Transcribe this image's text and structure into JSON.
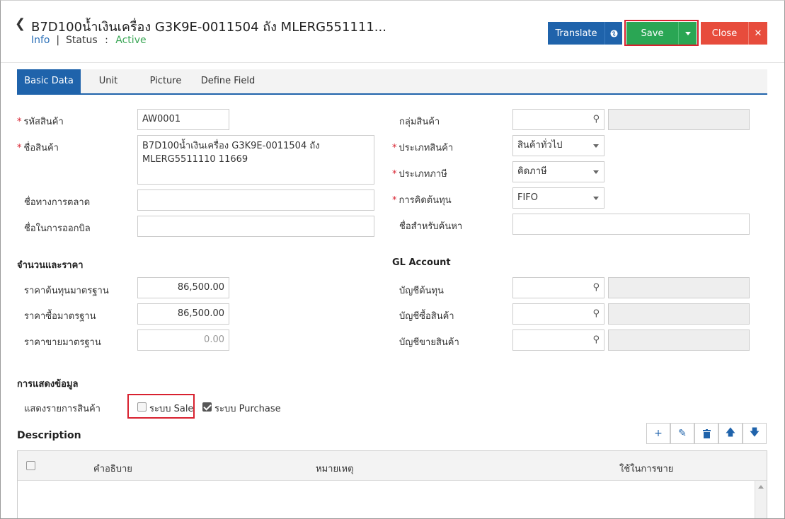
{
  "header": {
    "title": "B7D100น้ำเงินเครื่อง G3K9E-0011504 ถัง MLERG551111...",
    "info_link": "Info",
    "status_label": "Status",
    "status_sep": ":",
    "status_value": "Active",
    "translate_label": "Translate",
    "save_label": "Save",
    "close_label": "Close"
  },
  "tabs": [
    "Basic Data",
    "Unit",
    "Picture",
    "Define Field"
  ],
  "form": {
    "product_code_label": "รหัสสินค้า",
    "product_code_value": "AW0001",
    "product_name_label": "ชื่อสินค้า",
    "product_name_value": "B7D100น้ำเงินเครื่อง G3K9E-0011504 ถัง MLERG5511110 11669",
    "marketing_name_label": "ชื่อทางการตลาด",
    "marketing_name_value": "",
    "billing_name_label": "ชื่อในการออกบิล",
    "billing_name_value": "",
    "product_group_label": "กลุ่มสินค้า",
    "product_group_value": "",
    "product_type_label": "ประเภทสินค้า",
    "product_type_value": "สินค้าทั่วไป",
    "tax_type_label": "ประเภทภาษี",
    "tax_type_value": "คิดภาษี",
    "costing_label": "การคิดต้นทุน",
    "costing_value": "FIFO",
    "search_name_label": "ชื่อสำหรับค้นหา",
    "search_name_value": ""
  },
  "price_section": {
    "title": "จำนวนและราคา",
    "std_cost_label": "ราคาต้นทุนมาตรฐาน",
    "std_cost_value": "86,500.00",
    "std_buy_label": "ราคาซื้อมาตรฐาน",
    "std_buy_value": "86,500.00",
    "std_sell_label": "ราคาขายมาตรฐาน",
    "std_sell_placeholder": "0.00"
  },
  "gl_section": {
    "title": "GL Account",
    "cost_account_label": "บัญชีต้นทุน",
    "purchase_account_label": "บัญชีซื้อสินค้า",
    "sales_account_label": "บัญชีขายสินค้า"
  },
  "display_section": {
    "title": "การแสดงข้อมูล",
    "show_items_label": "แสดงรายการสินค้า",
    "sale_label": "ระบบ Sale",
    "sale_checked": false,
    "purchase_label": "ระบบ Purchase",
    "purchase_checked": true
  },
  "description": {
    "title": "Description",
    "columns": [
      "คำอธิบาย",
      "หมายเหตุ",
      "ใช้ในการขาย"
    ],
    "toolbar_icons": [
      "plus-icon",
      "pencil-icon",
      "trash-icon",
      "arrow-up-icon",
      "arrow-down-icon"
    ]
  },
  "colors": {
    "primary": "#1f63ab",
    "success": "#2aa654",
    "danger": "#e74c3c",
    "highlight": "#d8212f"
  }
}
